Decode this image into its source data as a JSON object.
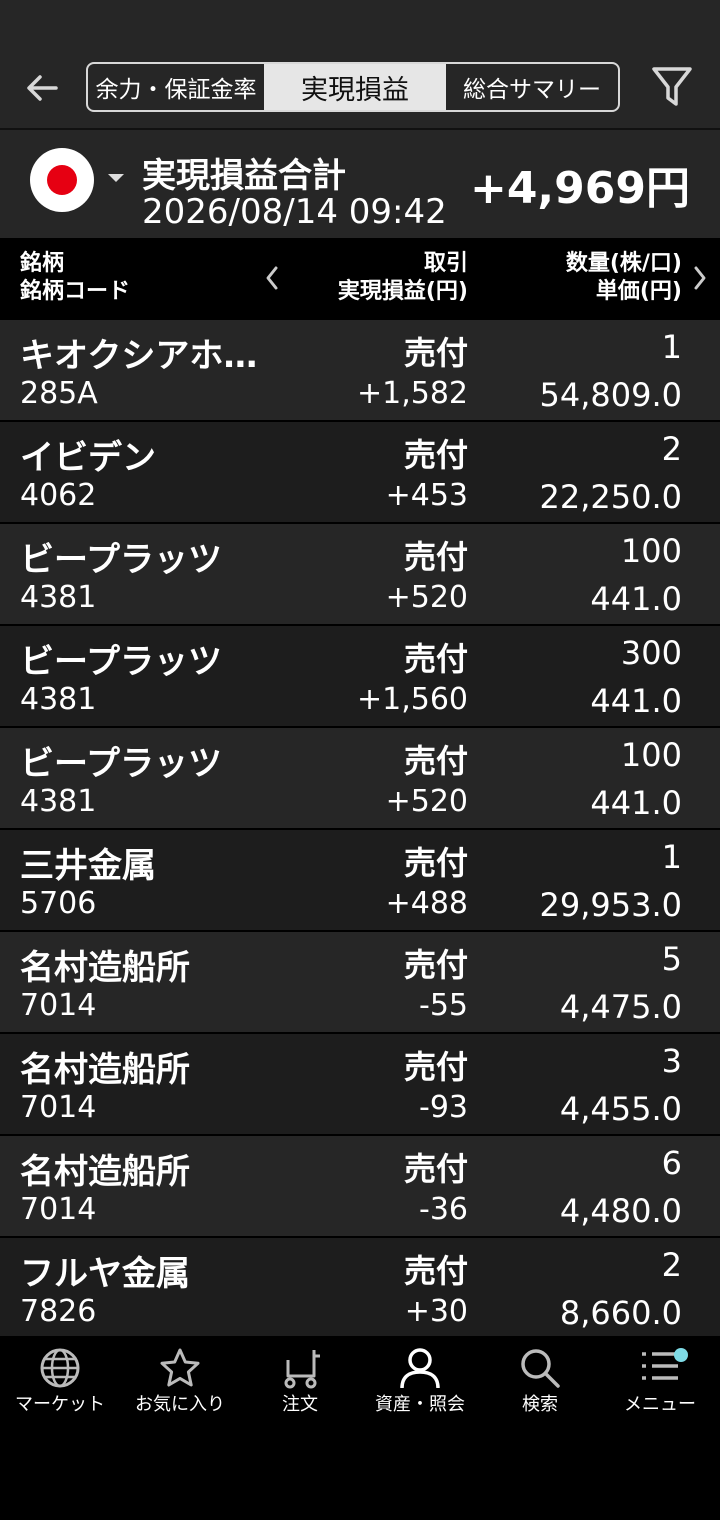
{
  "header": {
    "tabs": [
      {
        "label": "余力・保証金率"
      },
      {
        "label": "実現損益"
      },
      {
        "label": "総合サマリー"
      }
    ]
  },
  "summary": {
    "title": "実現損益合計",
    "datetime": "2026/08/14 09:42",
    "total": "+4,969円"
  },
  "columns": {
    "left_line1": "銘柄",
    "left_line2": "銘柄コード",
    "mid_line1": "取引",
    "mid_line2": "実現損益(円)",
    "right_line1": "数量(株/口)",
    "right_line2": "単価(円)"
  },
  "rows": [
    {
      "name": "キオクシアホ…",
      "code": "285A",
      "type": "売付",
      "pnl": "+1,582",
      "qty": "1",
      "price": "54,809.0"
    },
    {
      "name": "イビデン",
      "code": "4062",
      "type": "売付",
      "pnl": "+453",
      "qty": "2",
      "price": "22,250.0"
    },
    {
      "name": "ビープラッツ",
      "code": "4381",
      "type": "売付",
      "pnl": "+520",
      "qty": "100",
      "price": "441.0"
    },
    {
      "name": "ビープラッツ",
      "code": "4381",
      "type": "売付",
      "pnl": "+1,560",
      "qty": "300",
      "price": "441.0"
    },
    {
      "name": "ビープラッツ",
      "code": "4381",
      "type": "売付",
      "pnl": "+520",
      "qty": "100",
      "price": "441.0"
    },
    {
      "name": "三井金属",
      "code": "5706",
      "type": "売付",
      "pnl": "+488",
      "qty": "1",
      "price": "29,953.0"
    },
    {
      "name": "名村造船所",
      "code": "7014",
      "type": "売付",
      "pnl": "-55",
      "qty": "5",
      "price": "4,475.0"
    },
    {
      "name": "名村造船所",
      "code": "7014",
      "type": "売付",
      "pnl": "-93",
      "qty": "3",
      "price": "4,455.0"
    },
    {
      "name": "名村造船所",
      "code": "7014",
      "type": "売付",
      "pnl": "-36",
      "qty": "6",
      "price": "4,480.0"
    },
    {
      "name": "フルヤ金属",
      "code": "7826",
      "type": "売付",
      "pnl": "+30",
      "qty": "2",
      "price": "8,660.0"
    }
  ],
  "nav": [
    {
      "label": "マーケット",
      "icon": "globe-icon"
    },
    {
      "label": "お気に入り",
      "icon": "star-icon"
    },
    {
      "label": "注文",
      "icon": "cart-icon"
    },
    {
      "label": "資産・照会",
      "icon": "person-icon"
    },
    {
      "label": "検索",
      "icon": "search-icon"
    },
    {
      "label": "メニュー",
      "icon": "menu-icon"
    }
  ],
  "colors": {
    "accent_flag": "#e60012",
    "badge": "#7fdbe6",
    "row_dark": "#262626",
    "row_alt": "#1d1d1d"
  }
}
